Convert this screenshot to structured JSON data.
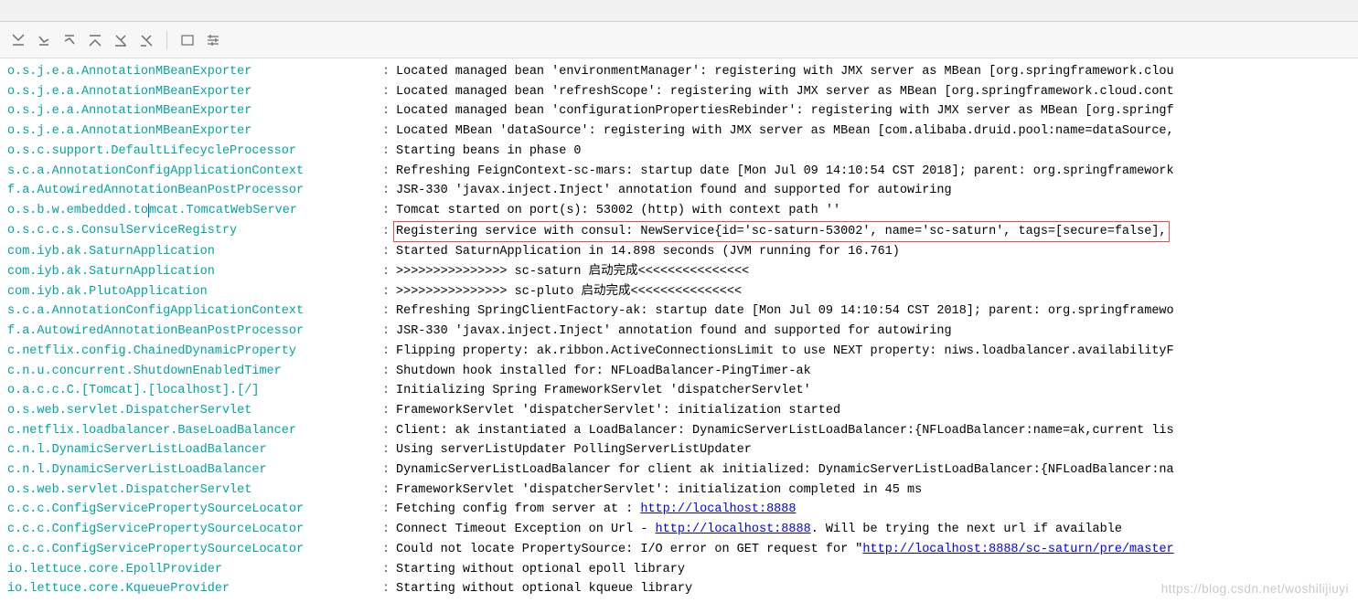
{
  "toolbar": {
    "icons": [
      "arrow-down-bar-icon",
      "arrow-down-right-icon",
      "arrow-up-left-icon",
      "arrow-up-bar-icon",
      "cross-down-icon",
      "cross-right-icon",
      "wrap-icon",
      "settings-icon"
    ]
  },
  "watermark": "https://blog.csdn.net/woshilijiuyi",
  "rows": [
    {
      "logger": "o.s.j.e.a.AnnotationMBeanExporter",
      "msg": "Located managed bean 'environmentManager': registering with JMX server as MBean [org.springframework.clou"
    },
    {
      "logger": "o.s.j.e.a.AnnotationMBeanExporter",
      "msg": "Located managed bean 'refreshScope': registering with JMX server as MBean [org.springframework.cloud.cont"
    },
    {
      "logger": "o.s.j.e.a.AnnotationMBeanExporter",
      "msg": "Located managed bean 'configurationPropertiesRebinder': registering with JMX server as MBean [org.springf"
    },
    {
      "logger": "o.s.j.e.a.AnnotationMBeanExporter",
      "msg": "Located MBean 'dataSource': registering with JMX server as MBean [com.alibaba.druid.pool:name=dataSource,"
    },
    {
      "logger": "o.s.c.support.DefaultLifecycleProcessor",
      "msg": "Starting beans in phase 0"
    },
    {
      "logger": "s.c.a.AnnotationConfigApplicationContext",
      "msg": "Refreshing FeignContext-sc-mars: startup date [Mon Jul 09 14:10:54 CST 2018]; parent: org.springframework"
    },
    {
      "logger": "f.a.AutowiredAnnotationBeanPostProcessor",
      "msg": "JSR-330 'javax.inject.Inject' annotation found and supported for autowiring"
    },
    {
      "logger": "o.s.b.w.embedded.tomcat.TomcatWebServer",
      "msg": "Tomcat started on port(s): 53002 (http) with context path ''",
      "cursor": true
    },
    {
      "logger": "o.s.c.c.s.ConsulServiceRegistry",
      "msg": "Registering service with consul: NewService{id='sc-saturn-53002', name='sc-saturn', tags=[secure=false],",
      "highlight": true
    },
    {
      "logger": "com.iyb.ak.SaturnApplication",
      "msg": "Started SaturnApplication in 14.898 seconds (JVM running for 16.761)"
    },
    {
      "logger": "com.iyb.ak.SaturnApplication",
      "msg": ">>>>>>>>>>>>>>> sc-saturn 启动完成<<<<<<<<<<<<<<<"
    },
    {
      "logger": "com.iyb.ak.PlutoApplication",
      "msg": ">>>>>>>>>>>>>>> sc-pluto 启动完成<<<<<<<<<<<<<<<"
    },
    {
      "logger": "s.c.a.AnnotationConfigApplicationContext",
      "msg": "Refreshing SpringClientFactory-ak: startup date [Mon Jul 09 14:10:54 CST 2018]; parent: org.springframewo"
    },
    {
      "logger": "f.a.AutowiredAnnotationBeanPostProcessor",
      "msg": "JSR-330 'javax.inject.Inject' annotation found and supported for autowiring"
    },
    {
      "logger": "c.netflix.config.ChainedDynamicProperty",
      "msg": "Flipping property: ak.ribbon.ActiveConnectionsLimit to use NEXT property: niws.loadbalancer.availabilityF"
    },
    {
      "logger": "c.n.u.concurrent.ShutdownEnabledTimer",
      "msg": "Shutdown hook installed for: NFLoadBalancer-PingTimer-ak"
    },
    {
      "logger": "o.a.c.c.C.[Tomcat].[localhost].[/]",
      "msg": "Initializing Spring FrameworkServlet 'dispatcherServlet'"
    },
    {
      "logger": "o.s.web.servlet.DispatcherServlet",
      "msg": "FrameworkServlet 'dispatcherServlet': initialization started"
    },
    {
      "logger": "c.netflix.loadbalancer.BaseLoadBalancer",
      "msg": "Client: ak instantiated a LoadBalancer: DynamicServerListLoadBalancer:{NFLoadBalancer:name=ak,current lis"
    },
    {
      "logger": "c.n.l.DynamicServerListLoadBalancer",
      "msg": "Using serverListUpdater PollingServerListUpdater"
    },
    {
      "logger": "c.n.l.DynamicServerListLoadBalancer",
      "msg": "DynamicServerListLoadBalancer for client ak initialized: DynamicServerListLoadBalancer:{NFLoadBalancer:na"
    },
    {
      "logger": "o.s.web.servlet.DispatcherServlet",
      "msg": "FrameworkServlet 'dispatcherServlet': initialization completed in 45 ms"
    },
    {
      "logger": "c.c.c.ConfigServicePropertySourceLocator",
      "msg_pre": "Fetching config from server at : ",
      "link": "http://localhost:8888"
    },
    {
      "logger": "c.c.c.ConfigServicePropertySourceLocator",
      "msg_pre": "Connect Timeout Exception on Url - ",
      "link": "http://localhost:8888",
      "msg_post": ". Will be trying the next url if available"
    },
    {
      "logger": "c.c.c.ConfigServicePropertySourceLocator",
      "msg_pre": "Could not locate PropertySource: I/O error on GET request for \"",
      "link": "http://localhost:8888/sc-saturn/pre/master"
    },
    {
      "logger": "io.lettuce.core.EpollProvider",
      "msg": "Starting without optional epoll library"
    },
    {
      "logger": "io.lettuce.core.KqueueProvider",
      "msg": "Starting without optional kqueue library"
    }
  ]
}
